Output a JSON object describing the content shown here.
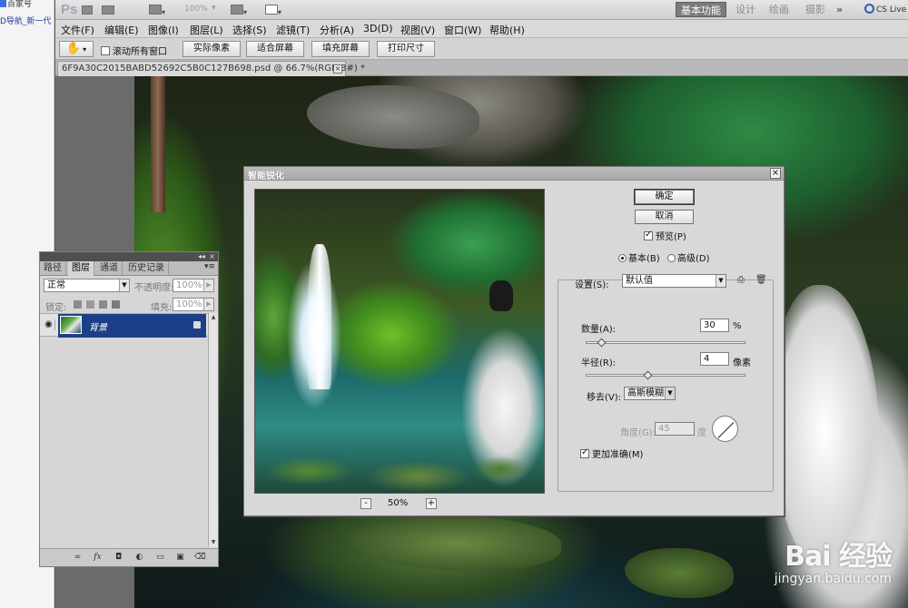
{
  "browser": {
    "item_top": "百家号",
    "item_second": "D导航_新一代"
  },
  "app": {
    "logo": "Ps",
    "zoom_level": "100%",
    "workspaces": [
      "基本功能",
      "设计",
      "绘画",
      "摄影"
    ],
    "more": "»",
    "cs_live": "CS Live"
  },
  "menu": [
    "文件(F)",
    "编辑(E)",
    "图像(I)",
    "图层(L)",
    "选择(S)",
    "滤镜(T)",
    "分析(A)",
    "3D(D)",
    "视图(V)",
    "窗口(W)",
    "帮助(H)"
  ],
  "options": {
    "scroll_all_windows": "滚动所有窗口",
    "actual_pixels": "实际像素",
    "fit_screen": "适合屏幕",
    "fill_screen": "填充屏幕",
    "print_size": "打印尺寸"
  },
  "document": {
    "tab_title": "6F9A30C2015BABD52692C5B0C127B698.psd @ 66.7%(RGB/8#) *",
    "close": "×"
  },
  "layers_panel": {
    "collapse": "◂◂",
    "close": "×",
    "tabs": [
      "路径",
      "图层",
      "通道",
      "历史记录"
    ],
    "active_tab": "图层",
    "menu": "▾≡",
    "blend_mode": "正常",
    "opacity_label": "不透明度:",
    "opacity_value": "100%",
    "lock_label": "锁定:",
    "fill_label": "填充:",
    "fill_value": "100%",
    "layer_name": "背景",
    "eye": "◉",
    "bottom_icons": [
      "∞",
      "fx",
      "◘",
      "◐",
      "▭",
      "▣",
      "⌫"
    ]
  },
  "dialog": {
    "title": "智能锐化",
    "close": "×",
    "zoom_minus": "-",
    "zoom_value": "50%",
    "zoom_plus": "+",
    "ok": "确定",
    "cancel": "取消",
    "preview": "预览(P)",
    "preview_checked": true,
    "mode_basic": "基本(B)",
    "mode_advanced": "高级(D)",
    "mode_selected": "basic",
    "settings_label": "设置(S):",
    "settings_value": "默认值",
    "amount_label": "数量(A):",
    "amount_value": "30",
    "amount_unit": "%",
    "amount_fraction": 0.1,
    "radius_label": "半径(R):",
    "radius_value": "4",
    "radius_unit": "像素",
    "radius_fraction": 0.39,
    "remove_label": "移去(V):",
    "remove_value": "高斯模糊",
    "angle_label": "角度(G):",
    "angle_value": "45",
    "angle_unit": "度",
    "more_accurate": "更加准确(M)",
    "more_accurate_checked": true
  },
  "watermark": {
    "main": "Bai 经验",
    "url": "jingyan.baidu.com"
  }
}
